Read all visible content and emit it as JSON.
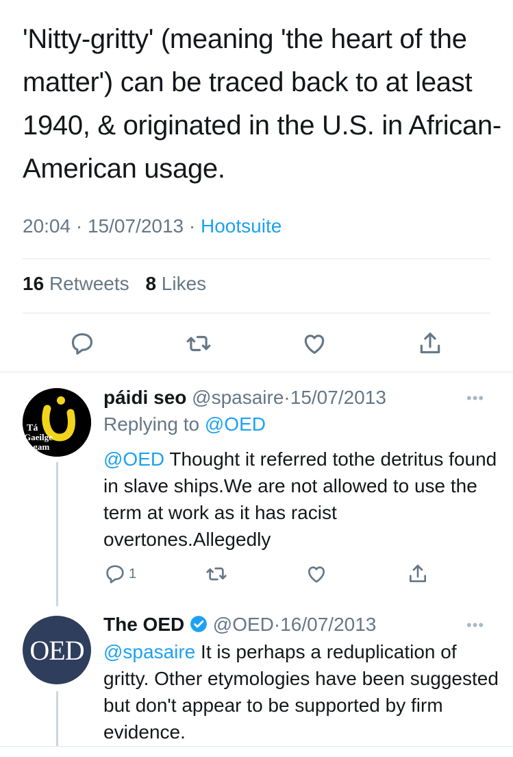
{
  "main_tweet": {
    "text": "'Nitty-gritty' (meaning 'the heart of the matter') can be traced back to at least 1940, & originated in the U.S. in African-American usage.",
    "time": "20:04",
    "date": "15/07/2013",
    "source": "Hootsuite",
    "retweets_count": "16",
    "retweets_label": "Retweets",
    "likes_count": "8",
    "likes_label": "Likes"
  },
  "replies": [
    {
      "name": "páidi seo",
      "handle": "@spasaire",
      "date": "15/07/2013",
      "replying_prefix": "Replying to",
      "replying_to": "@OED",
      "mention": "@OED",
      "text": " Thought it referred tothe detritus found in slave ships.We are not allowed to use the term at work as it has racist overtones.Allegedly",
      "reply_count": "1",
      "avatar_text": [
        "Tá",
        "Gaeilge",
        "Agam"
      ]
    },
    {
      "name": "The OED",
      "handle": "@OED",
      "date": "16/07/2013",
      "mention": "@spasaire",
      "text": " It is perhaps a reduplication of gritty. Other etymologies have been suggested but don't appear to be supported by firm evidence.",
      "avatar_text": "OED"
    }
  ],
  "separator": "·",
  "more_glyph": "•••",
  "colors": {
    "link": "#1da1f2",
    "muted": "#657786",
    "oed_avatar": "#2f3e5d",
    "verified": "#1da1f2"
  },
  "icons": [
    "reply-icon",
    "retweet-icon",
    "like-icon",
    "share-icon",
    "verified-badge-icon",
    "more-icon"
  ]
}
